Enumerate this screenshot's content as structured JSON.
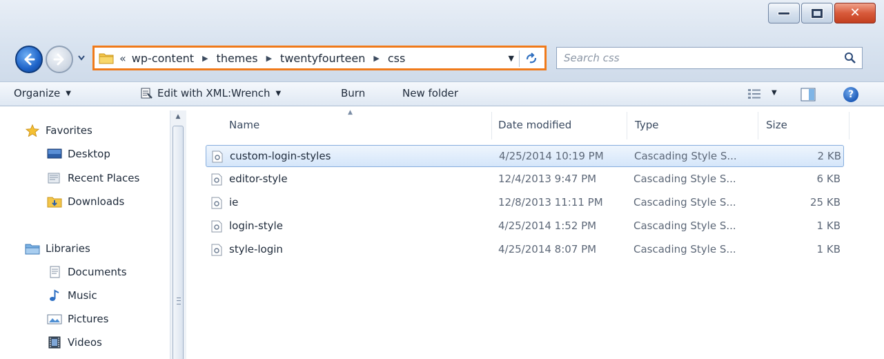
{
  "window": {
    "controls": [
      "minimize",
      "maximize",
      "close"
    ]
  },
  "address": {
    "overflow": "«",
    "crumbs": [
      "wp-content",
      "themes",
      "twentyfourteen",
      "css"
    ]
  },
  "search": {
    "placeholder": "Search css"
  },
  "toolbar": {
    "organize": "Organize",
    "edit_with": "Edit with XML:Wrench",
    "burn": "Burn",
    "new_folder": "New folder"
  },
  "nav_pane": {
    "favorites": "Favorites",
    "desktop": "Desktop",
    "recent_places": "Recent Places",
    "downloads": "Downloads",
    "libraries": "Libraries",
    "documents": "Documents",
    "music": "Music",
    "pictures": "Pictures",
    "videos": "Videos"
  },
  "columns": {
    "name": "Name",
    "date": "Date modified",
    "type": "Type",
    "size": "Size"
  },
  "files": [
    {
      "name": "custom-login-styles",
      "date": "4/25/2014 10:19 PM",
      "type": "Cascading Style S...",
      "size": "2 KB",
      "selected": true
    },
    {
      "name": "editor-style",
      "date": "12/4/2013 9:47 PM",
      "type": "Cascading Style S...",
      "size": "6 KB",
      "selected": false
    },
    {
      "name": "ie",
      "date": "12/8/2013 11:11 PM",
      "type": "Cascading Style S...",
      "size": "25 KB",
      "selected": false
    },
    {
      "name": "login-style",
      "date": "4/25/2014 1:52 PM",
      "type": "Cascading Style S...",
      "size": "1 KB",
      "selected": false
    },
    {
      "name": "style-login",
      "date": "4/25/2014 8:07 PM",
      "type": "Cascading Style S...",
      "size": "1 KB",
      "selected": false
    }
  ],
  "colors": {
    "address_highlight": "#f07a1a",
    "selection_border": "#84acdd",
    "selection_fill": "#d5e6fa"
  },
  "icons": {
    "back": "back-arrow-icon",
    "forward": "forward-arrow-icon",
    "refresh": "refresh-icon",
    "search": "search-icon",
    "help": "help-icon",
    "file": "css-file-icon"
  }
}
